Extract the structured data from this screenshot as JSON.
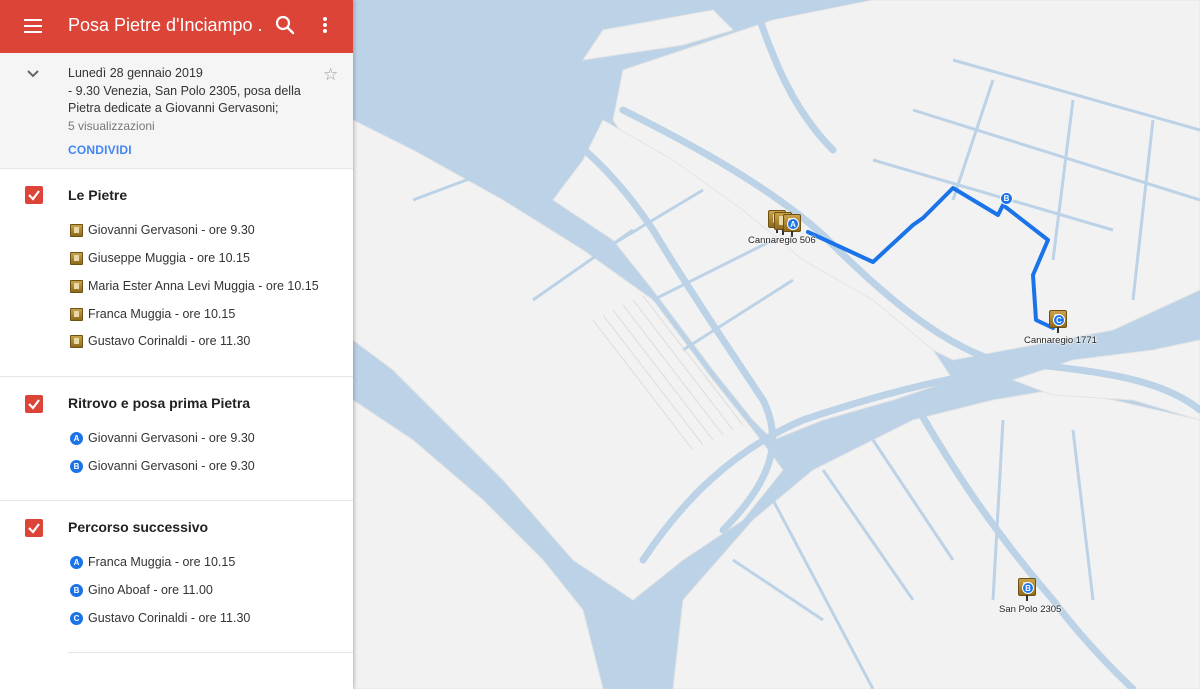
{
  "header": {
    "title": "Posa Pietre d'Inciampo ...",
    "menu_icon": "hamburger-menu-icon",
    "search_icon": "search-icon",
    "more_icon": "more-vert-icon"
  },
  "info": {
    "description_lines": [
      "Lunedì 28 gennaio 2019",
      "- 9.30 Venezia, San Polo 2305, posa della",
      "Pietra dedicate a Giovanni Gervasoni;"
    ],
    "views": "5 visualizzazioni",
    "share_label": "CONDIVIDI",
    "star_glyph": "☆"
  },
  "layers": [
    {
      "name": "Le Pietre",
      "items": [
        {
          "icon": "stone",
          "label": "Giovanni Gervasoni - ore 9.30"
        },
        {
          "icon": "stone",
          "label": "Giuseppe Muggia - ore 10.15"
        },
        {
          "icon": "stone",
          "label": "Maria Ester Anna Levi Muggia - ore 10.15"
        },
        {
          "icon": "stone",
          "label": "Franca Muggia - ore 10.15"
        },
        {
          "icon": "stone",
          "label": "Gustavo Corinaldi - ore 11.30"
        }
      ]
    },
    {
      "name": "Ritrovo e posa prima Pietra",
      "items": [
        {
          "icon": "A",
          "label": "Giovanni Gervasoni - ore 9.30"
        },
        {
          "icon": "B",
          "label": "Giovanni Gervasoni - ore 9.30"
        }
      ]
    },
    {
      "name": "Percorso successivo",
      "items": [
        {
          "icon": "A",
          "label": "Franca Muggia - ore 10.15"
        },
        {
          "icon": "B",
          "label": "Gino  Aboaf - ore 11.00"
        },
        {
          "icon": "C",
          "label": "Gustavo Corinaldi - ore 11.30"
        }
      ]
    }
  ],
  "map": {
    "labels": {
      "cannaregio_506": "Cannaregio 506",
      "cannaregio_1771": "Cannaregio 1771",
      "san_polo_2305": "San Polo 2305"
    },
    "pin_badges": {
      "a": "A",
      "b": "B",
      "c": "C",
      "route_b": "B"
    },
    "colors": {
      "water": "#bcd2e6",
      "land": "#f2f2f2",
      "route": "#1a73e8",
      "header": "#db4437"
    }
  }
}
